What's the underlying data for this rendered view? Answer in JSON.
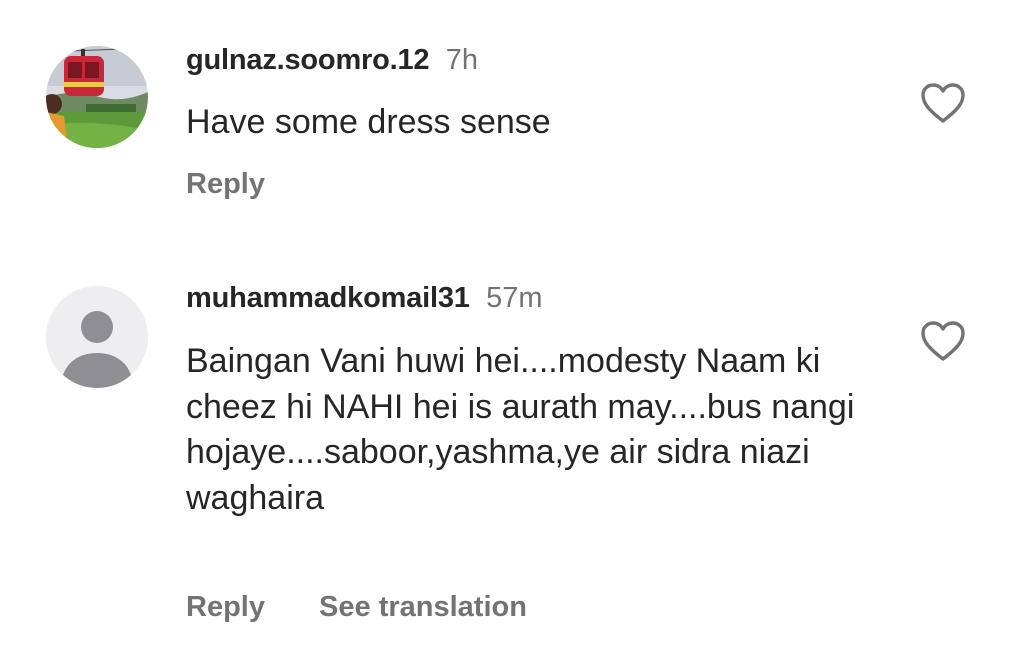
{
  "comments": [
    {
      "username": "gulnaz.soomro.12",
      "time": "7h",
      "text": "Have some dress sense",
      "reply_label": "Reply",
      "avatar_icon": "profile-photo",
      "like_icon": "heart-outline-icon"
    },
    {
      "username": "muhammadkomail31",
      "time": "57m",
      "text": "Baingan Vani huwi hei....modesty Naam ki cheez hi NAHI hei is aurath may....bus nangi hojaye....saboor,yashma,ye air sidra niazi waghaira",
      "reply_label": "Reply",
      "see_translation_label": "See translation",
      "avatar_icon": "default-avatar-icon",
      "like_icon": "heart-outline-icon"
    }
  ],
  "colors": {
    "text_primary": "#262626",
    "text_secondary": "#737373",
    "avatar_placeholder_bg": "#eeeef0",
    "avatar_placeholder_fg": "#8e8e93"
  }
}
